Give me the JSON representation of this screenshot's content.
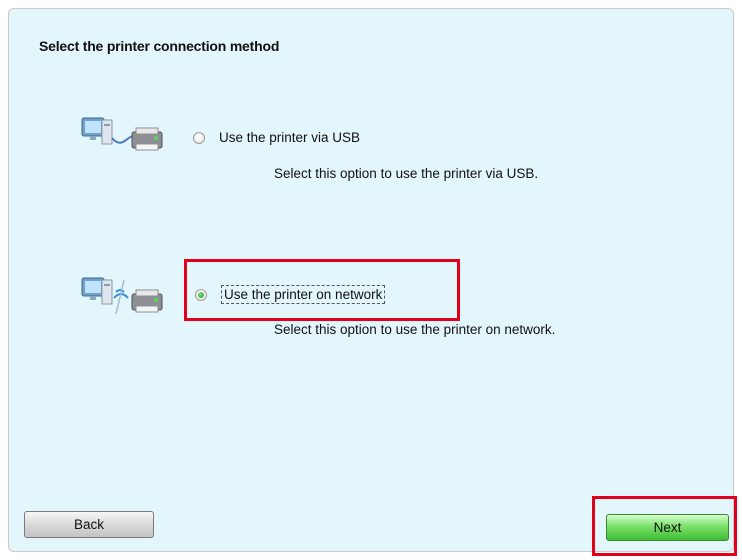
{
  "dialog": {
    "title": "Select the printer connection method"
  },
  "options": [
    {
      "label": "Use the printer via USB",
      "description": "Select this option to use the printer via USB.",
      "selected": false,
      "icon": "usb-connection-icon"
    },
    {
      "label": "Use the printer on network",
      "description": "Select this option to use the printer on network.",
      "selected": true,
      "icon": "network-connection-icon"
    }
  ],
  "buttons": {
    "back_label": "Back",
    "next_label": "Next"
  },
  "colors": {
    "background": "#e3f6fb",
    "highlight": "#e3001b",
    "next_button": "#4fca42",
    "radio_selected": "#1f9a2a"
  }
}
